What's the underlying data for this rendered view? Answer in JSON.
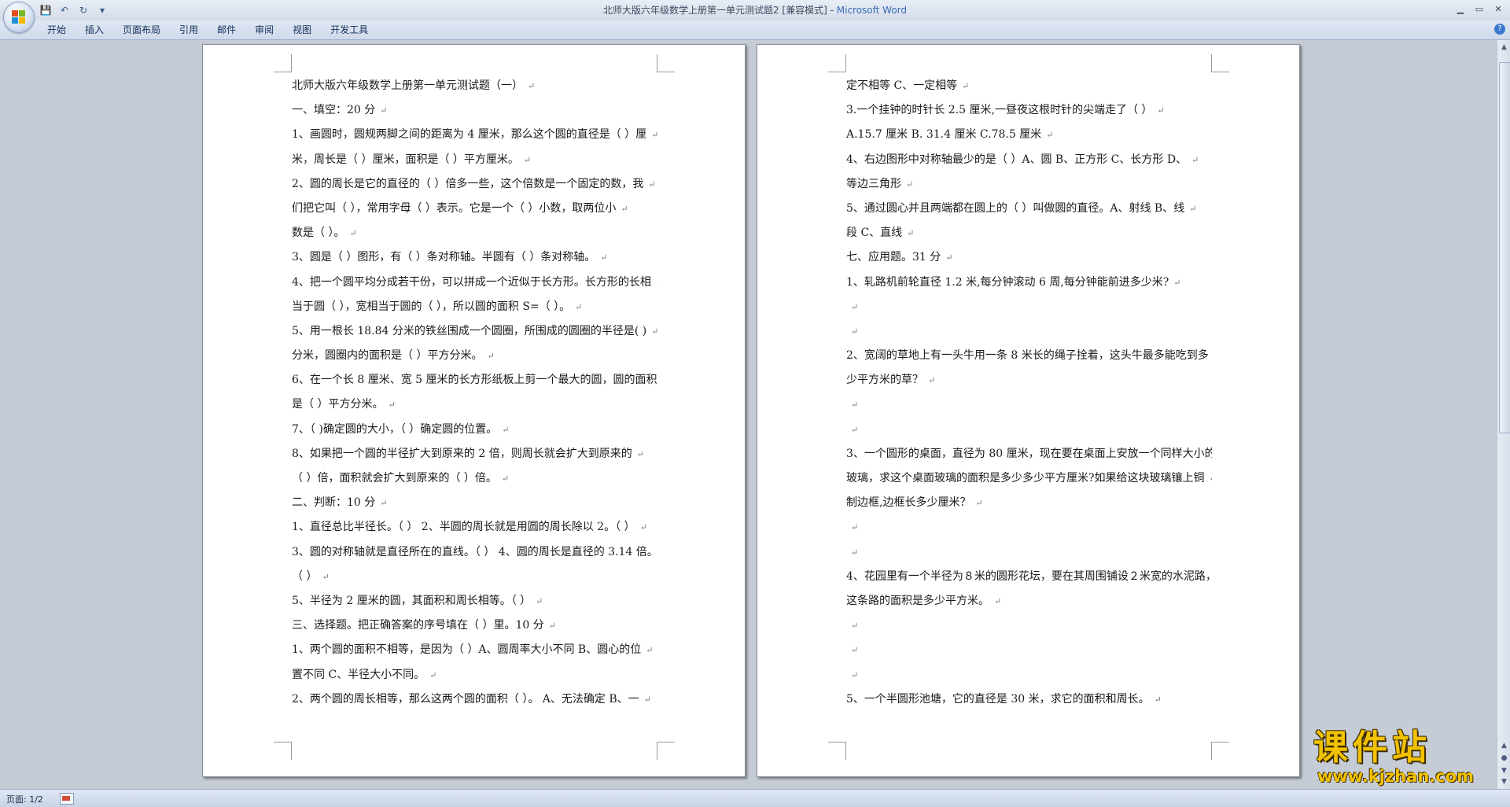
{
  "window": {
    "title_doc": "北师大版六年级数学上册第一单元测试题2 [兼容模式] - ",
    "title_app": "Microsoft Word"
  },
  "qat": {
    "save": "💾",
    "undo": "↶",
    "redo": "↻",
    "customize": "▾"
  },
  "ribbon": {
    "tabs": [
      "开始",
      "插入",
      "页面布局",
      "引用",
      "邮件",
      "审阅",
      "视图",
      "开发工具"
    ],
    "help": "?"
  },
  "pages": [
    {
      "lines": [
        "北师大版六年级数学上册第一单元测试题（一）",
        "一、填空：20 分",
        "1、画圆时，圆规两脚之间的距离为 4 厘米，那么这个圆的直径是（     ）厘",
        "米，周长是（      ）厘米，面积是（      ）平方厘米。",
        "2、圆的周长是它的直径的（      ）倍多一些，这个倍数是一个固定的数，我",
        "们把它叫（      ），常用字母（    ）表示。它是一个（        ）小数，取两位小",
        "数是（      ）。",
        "3、圆是（          ）图形，有（     ）条对称轴。半圆有（     ）条对称轴。",
        "4、把一个圆平均分成若干份，可以拼成一个近似于长方形。长方形的长相",
        "当于圆（        ），宽相当于圆的（        ），所以圆的面积 S=（          ）。",
        "5、用一根长 18.84 分米的铁丝围成一个圆圈，所围成的圆圈的半径是(        )",
        "分米，圆圈内的面积是（          ）平方分米。",
        "6、在一个长 8 厘米、宽 5 厘米的长方形纸板上剪一个最大的圆，圆的面积",
        "是（        ）平方分米。",
        "7、（    )确定圆的大小，（          ）确定圆的位置。",
        "8、如果把一个圆的半径扩大到原来的 2 倍，则周长就会扩大到原来的",
        "（            ）倍，面积就会扩大到原来的（            ）倍。",
        "二、判断：10 分",
        "1、直径总比半径长。（     ）        2、半圆的周长就是用圆的周长除以 2。（    ）",
        "3、圆的对称轴就是直径所在的直线。（     ）   4、圆的周长是直径的 3.14 倍。",
        "（     ）",
        "5、半径为 2 厘米的圆，其面积和周长相等。（     ）",
        "三、选择题。把正确答案的序号填在（ ）里。10 分",
        " 1、两个圆的面积不相等，是因为（     ）A、圆周率大小不同  B、圆心的位",
        "置不同   C、半径大小不同。",
        " 2、两个圆的周长相等，那么这两个圆的面积（     ）。 A、无法确定   B、一"
      ]
    },
    {
      "lines": [
        "定不相等    C、一定相等",
        "3.一个挂钟的时针长 2.5 厘米,一昼夜这根时针的尖端走了（      ）",
        "A.15.7 厘米         B. 31.4 厘米        C.78.5 厘米",
        " 4、右边图形中对称轴最少的是（      ）A、圆   B、正方形   C、长方形   D、",
        "等边三角形",
        " 5、通过圆心并且两端都在圆上的（      ）叫做圆的直径。A、射线     B、线",
        "段     C、直线",
        "七、应用题。31 分",
        "1、轧路机前轮直径 1.2 米,每分钟滚动 6 周,每分钟能前进多少米?",
        "",
        "",
        "2、宽阔的草地上有一头牛用一条 8 米长的绳子拴着，这头牛最多能吃到多",
        "少平方米的草？",
        "",
        "",
        "3、一个圆形的桌面，直径为 80 厘米，现在要在桌面上安放一个同样大小的",
        "玻璃，求这个桌面玻璃的面积是多少多少平方厘米?如果给这块玻璃镶上铜",
        "制边框,边框长多少厘米？",
        "",
        "",
        "4、花园里有一个半径为８米的圆形花坛，要在其周围铺设２米宽的水泥路，",
        "这条路的面积是多少平方米。",
        "",
        "",
        "",
        "5、一个半圆形池塘，它的直径是 30 米，求它的面积和周长。"
      ]
    }
  ],
  "statusbar": {
    "page_indicator": "页面: 1/2"
  },
  "watermark": {
    "title": "课件站",
    "url": "www.kjzhan.com"
  }
}
